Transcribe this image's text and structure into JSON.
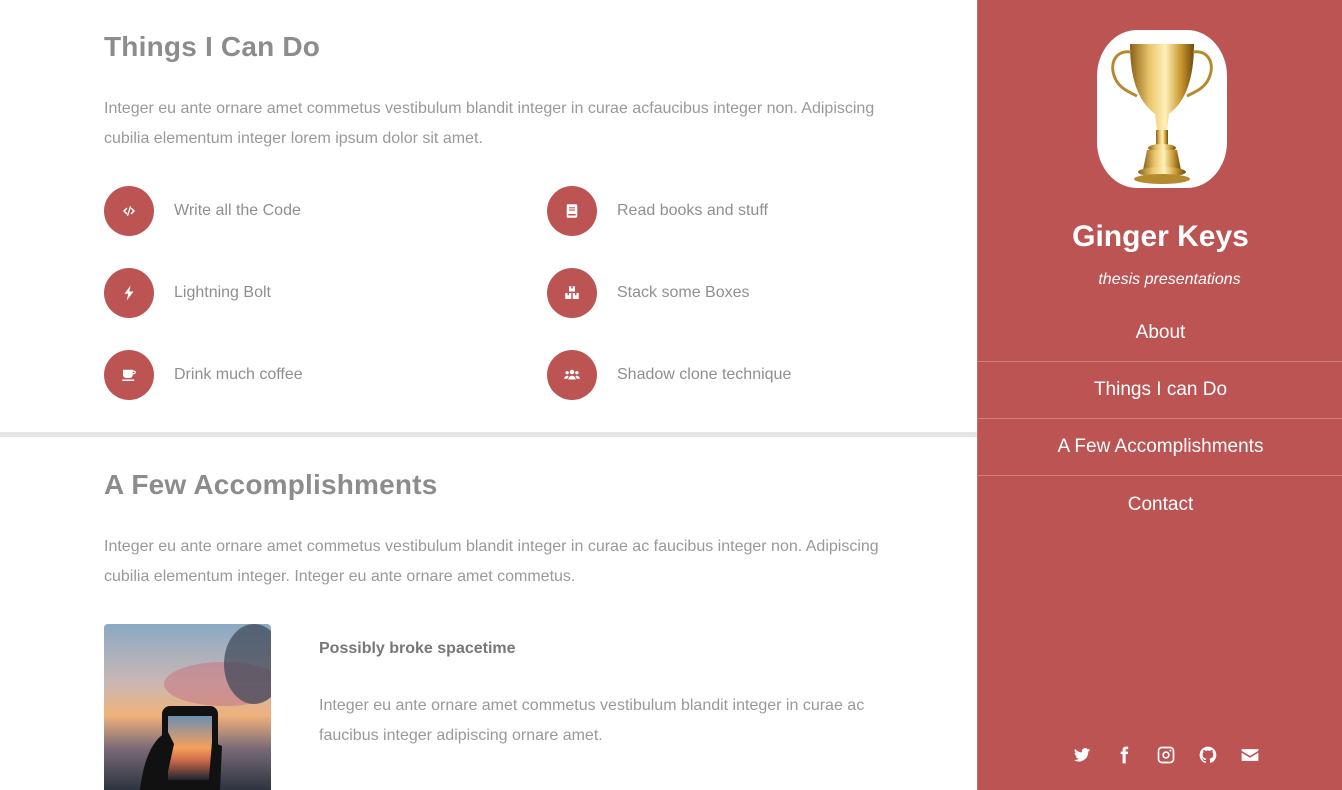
{
  "skills_section": {
    "title": "Things I Can Do",
    "intro": "Integer eu ante ornare amet commetus vestibulum blandit integer in curae acfaucibus integer non. Adipiscing cubilia elementum integer lorem ipsum dolor sit amet.",
    "items": [
      {
        "label": "Write all the Code",
        "icon": "code-icon"
      },
      {
        "label": "Read books and stuff",
        "icon": "book-icon"
      },
      {
        "label": "Lightning Bolt",
        "icon": "bolt-icon"
      },
      {
        "label": "Stack some Boxes",
        "icon": "boxes-icon"
      },
      {
        "label": "Drink much coffee",
        "icon": "coffee-icon"
      },
      {
        "label": "Shadow clone technique",
        "icon": "users-icon"
      }
    ]
  },
  "accomplishments_section": {
    "title": "A Few Accomplishments",
    "intro": "Integer eu ante ornare amet commetus vestibulum blandit integer in curae ac faucibus integer non. Adipiscing cubilia elementum integer. Integer eu ante ornare amet commetus.",
    "items": [
      {
        "title": "Possibly broke spacetime",
        "text": "Integer eu ante ornare amet commetus vestibulum blandit integer in curae ac faucibus integer adipiscing ornare amet.",
        "image": "phone-sunset-photo"
      }
    ]
  },
  "sidebar": {
    "avatar": "trophy-image",
    "name": "Ginger Keys",
    "tagline": "thesis presentations",
    "nav": [
      "About",
      "Things I can Do",
      "A Few Accomplishments",
      "Contact"
    ],
    "social": [
      "twitter-icon",
      "facebook-icon",
      "instagram-icon",
      "github-icon",
      "envelope-icon"
    ]
  },
  "colors": {
    "accent": "#bd5454",
    "heading": "#8c8c8c",
    "body_text": "#999999",
    "divider": "#e5e5e5"
  }
}
